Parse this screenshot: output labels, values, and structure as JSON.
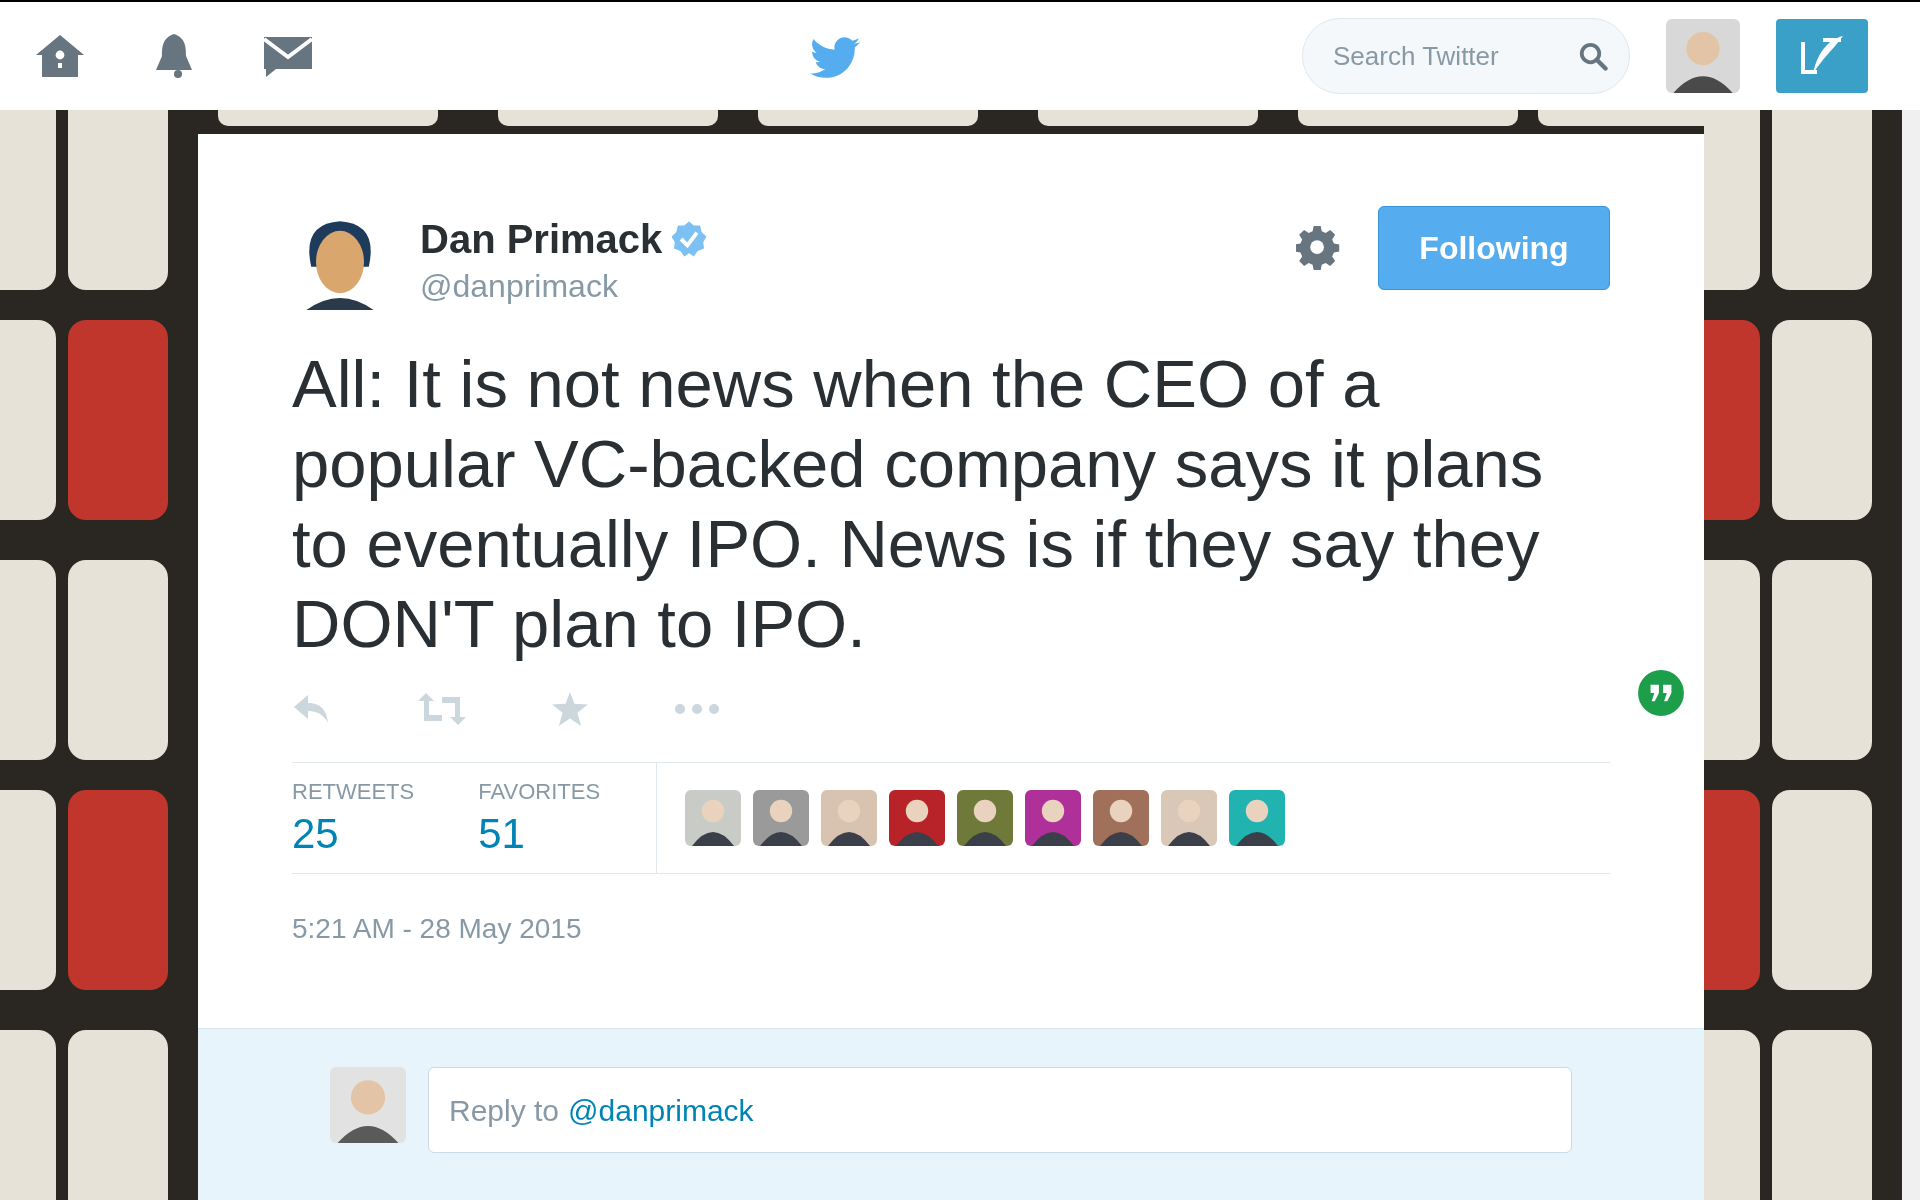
{
  "top_bar": {
    "search": {
      "placeholder": "Search Twitter"
    }
  },
  "tweet": {
    "author": {
      "name": "Dan Primack",
      "verified": true,
      "handle": "@danprimack"
    },
    "follow_button": {
      "label": "Following",
      "selected": true
    },
    "text": "All: It is not news when the CEO of a popular VC-backed company says it plans to eventually IPO. News is if they say they DON'T plan to IPO.",
    "stats": [
      {
        "label": "RETWEETS",
        "value": "25"
      },
      {
        "label": "FAVORITES",
        "value": "51"
      }
    ],
    "timestamp": "5:21 AM - 28 May 2015"
  },
  "reply": {
    "prompt": "Reply to",
    "mention": "@danprimack"
  }
}
